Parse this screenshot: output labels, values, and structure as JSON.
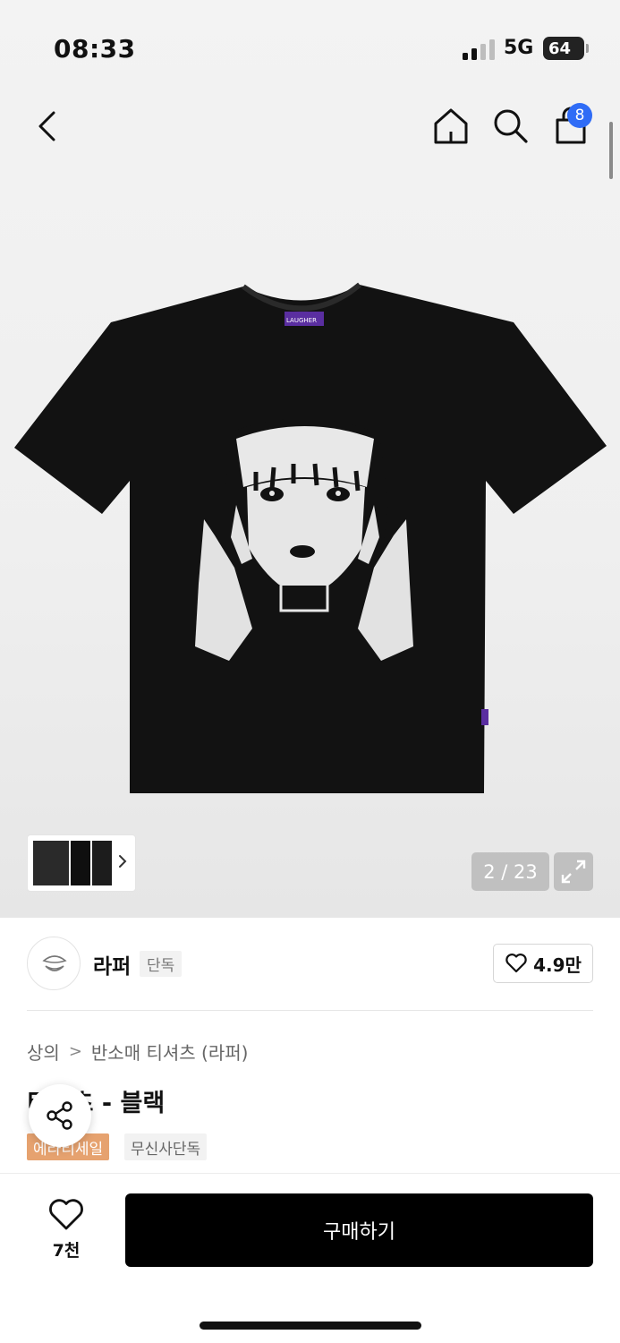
{
  "status_bar": {
    "time": "08:33",
    "network": "5G",
    "battery": "64"
  },
  "nav": {
    "back_icon": "chevron-left-icon",
    "home_icon": "home-icon",
    "search_icon": "search-icon",
    "cart_icon": "shopping-bag-icon",
    "cart_count": "8"
  },
  "gallery": {
    "tshirt_label": "LAUGHER",
    "counter": "2 / 23",
    "expand_icon": "expand-icon"
  },
  "brand": {
    "name": "라퍼",
    "tag": "단독",
    "likes": "4.9만",
    "like_icon": "heart-outline-icon"
  },
  "breadcrumb": [
    "상의",
    "반소매 티셔츠 (라퍼)"
  ],
  "product": {
    "title": "    티셔츠 - 블랙",
    "tag_sale": "에라티세일",
    "tag_exclusive": "무신사단독"
  },
  "share": {
    "icon": "share-icon"
  },
  "bottom_bar": {
    "wish_count": "7천",
    "buy_label": "구매하기"
  },
  "colors": {
    "cart_badge": "#2f6cf6",
    "sale_tag": "#e6a26f",
    "buy_button": "#000000"
  }
}
